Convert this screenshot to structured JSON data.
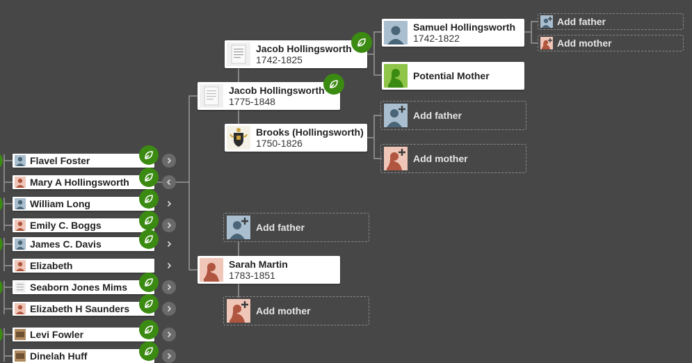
{
  "descendants": [
    {
      "name": "Flavel Foster",
      "sex": "male",
      "chevron": "right",
      "hint": true
    },
    {
      "name": "Mary A Hollingsworth",
      "sex": "female",
      "chevron": "left",
      "hint": true
    },
    {
      "name": "William Long",
      "sex": "male",
      "chevron": "right",
      "hint": true
    },
    {
      "name": "Emily C. Boggs",
      "sex": "female",
      "chevron": "right",
      "hint": true
    },
    {
      "name": "James C. Davis",
      "sex": "male",
      "chevron": "right",
      "hint": true
    },
    {
      "name": "Elizabeth",
      "sex": "female",
      "chevron": "right",
      "hint": false
    },
    {
      "name": "Seaborn Jones Mims",
      "sex": "document",
      "chevron": "right",
      "hint": true
    },
    {
      "name": "Elizabeth H Saunders",
      "sex": "female",
      "chevron": "right",
      "hint": true
    },
    {
      "name": "Levi Fowler",
      "sex": "photo",
      "chevron": "right",
      "hint": true
    },
    {
      "name": "Dinelah Huff",
      "sex": "photo",
      "chevron": "right",
      "hint": true
    }
  ],
  "parents": {
    "father": {
      "name": "Jacob Hollingsworth",
      "dates": "1775-1848",
      "photo": "document"
    },
    "mother": {
      "name": "Sarah Martin",
      "dates": "1783-1851",
      "photo": "female"
    }
  },
  "grandparents": {
    "paternal_father": {
      "name": "Jacob Hollingsworth",
      "dates": "1742-1825",
      "photo": "document"
    },
    "paternal_mother": {
      "name": "Brooks (Hollingsworth)",
      "dates": "1750-1826",
      "photo": "crest"
    },
    "maternal_add_father": "Add father",
    "maternal_add_mother": "Add mother"
  },
  "great_grandparents": {
    "father": {
      "name": "Samuel Hollingsworth",
      "dates": "1742-1822",
      "photo": "male"
    },
    "mother": {
      "name": "Potential Mother",
      "photo": "potential"
    },
    "add_father": "Add father",
    "add_mother": "Add mother"
  },
  "top_right": {
    "add_father": "Add father",
    "add_mother": "Add mother"
  },
  "colors": {
    "background": "#474747",
    "hint_green": "#3b8a12",
    "male_bg": "#a9bfcf",
    "male_fg": "#4a6478",
    "female_bg": "#efc6b8",
    "female_fg": "#b0553f",
    "potential_bg": "#8fc548",
    "potential_fg": "#3b8a12"
  },
  "icons": {
    "hint": "leaf-hint-icon",
    "chevron_right": "chevron-right-icon",
    "chevron_left": "chevron-left-icon",
    "add": "plus-icon"
  }
}
